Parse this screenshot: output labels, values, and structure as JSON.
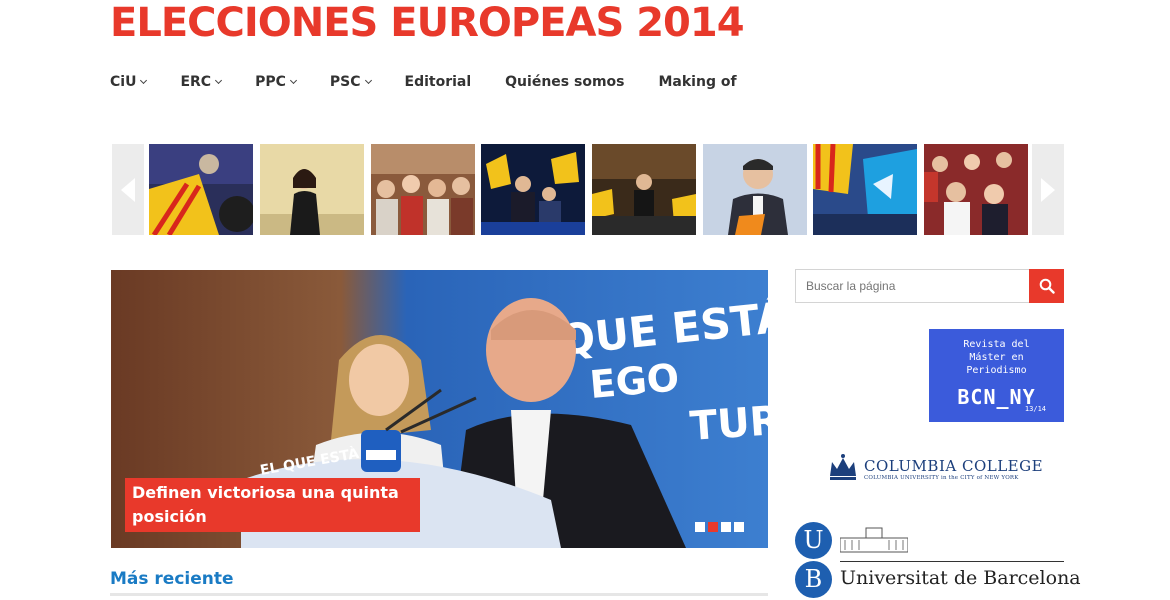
{
  "site": {
    "title": "ELECCIONES EUROPEAS 2014"
  },
  "nav": {
    "items": [
      {
        "label": "CiU",
        "dropdown": true
      },
      {
        "label": "ERC",
        "dropdown": true
      },
      {
        "label": "PPC",
        "dropdown": true
      },
      {
        "label": "PSC",
        "dropdown": true
      },
      {
        "label": "Editorial",
        "dropdown": false
      },
      {
        "label": "Quiénes somos",
        "dropdown": false
      },
      {
        "label": "Making of",
        "dropdown": false
      }
    ]
  },
  "carousel": {
    "prev_icon": "chevron-left-icon",
    "next_icon": "chevron-right-icon",
    "thumbnails": [
      "rally-flags-photo",
      "woman-speaker-photo",
      "crowd-supporters-photo",
      "stage-flags-photo",
      "speaker-crowd-photo",
      "candidate-portrait-photo",
      "blue-flags-photo",
      "cheering-crowd-photo"
    ]
  },
  "hero": {
    "caption": "Definen victoriosa una quinta posición",
    "backdrop_text_1": "QUE ESTÁ",
    "backdrop_text_2": "EGO",
    "backdrop_text_3": "TURO",
    "podium_text": "EL QUE ESTÀ",
    "slides": 4,
    "active_slide": 2
  },
  "section": {
    "title": "Más reciente"
  },
  "sidebar": {
    "search_placeholder": "Buscar la página",
    "search_icon": "search-icon",
    "magazine": {
      "line1": "Revista del",
      "line2": "Máster en",
      "line3": "Periodismo",
      "logo": "BCN_NY",
      "year": "13/14"
    },
    "columbia": {
      "name": "COLUMBIA COLLEGE",
      "sub": "COLUMBIA UNIVERSITY in the CITY of NEW YORK"
    },
    "ub": {
      "letter1": "U",
      "letter2": "B",
      "name": "Universitat de Barcelona"
    }
  },
  "colors": {
    "accent": "#e8392b",
    "link": "#1a7bc4",
    "magazine": "#3b5bdb",
    "ub": "#1e5fb0"
  }
}
